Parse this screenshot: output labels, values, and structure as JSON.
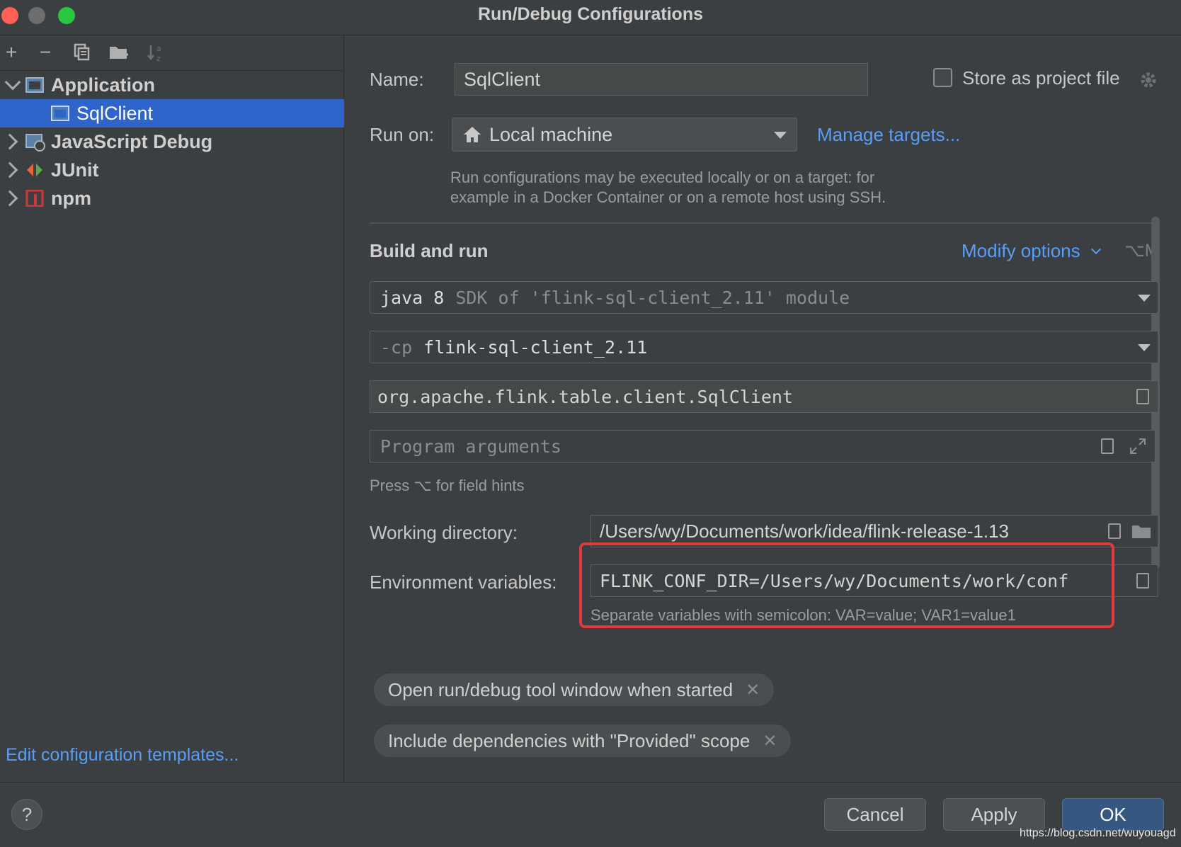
{
  "window": {
    "title": "Run/Debug Configurations"
  },
  "toolbar": {
    "add_icon": "plus-icon",
    "remove_icon": "minus-icon",
    "copy_icon": "copy-icon",
    "folder_icon": "new-folder-icon",
    "sort_icon": "sort-alpha-icon"
  },
  "tree": {
    "application": "Application",
    "sqlclient": "SqlClient",
    "jsdebug": "JavaScript Debug",
    "junit": "JUnit",
    "npm": "npm"
  },
  "left_footer": {
    "edit_templates": "Edit configuration templates..."
  },
  "form": {
    "name_label": "Name:",
    "name_value": "SqlClient",
    "store_label": "Store as project file",
    "runon_label": "Run on:",
    "runon_value": "Local machine",
    "manage_targets": "Manage targets...",
    "runon_hint_1": "Run configurations may be executed locally or on a target: for",
    "runon_hint_2": "example in a Docker Container or on a remote host using SSH.",
    "section_title": "Build and run",
    "modify_options": "Modify options",
    "modify_shortcut": "⌥M",
    "jdk_main": "java 8",
    "jdk_detail": "SDK of 'flink-sql-client_2.11' module",
    "cp_prefix": "-cp",
    "cp_value": "flink-sql-client_2.11",
    "main_class": "org.apache.flink.table.client.SqlClient",
    "program_args_placeholder": "Program arguments",
    "field_hint": "Press ⌥ for field hints",
    "workdir_label": "Working directory:",
    "workdir_value": "/Users/wy/Documents/work/idea/flink-release-1.13",
    "env_label": "Environment variables:",
    "env_value": "FLINK_CONF_DIR=/Users/wy/Documents/work/conf",
    "env_hint": "Separate variables with semicolon: VAR=value; VAR1=value1",
    "chip_1": "Open run/debug tool window when started",
    "chip_2": "Include dependencies with \"Provided\" scope"
  },
  "buttons": {
    "help": "?",
    "cancel": "Cancel",
    "apply": "Apply",
    "ok": "OK"
  },
  "watermark": "https://blog.csdn.net/wuyouagd",
  "colors": {
    "selection": "#2f65ca",
    "link": "#589df6",
    "highlight_box": "#e03a3a",
    "primary_button": "#365880"
  }
}
